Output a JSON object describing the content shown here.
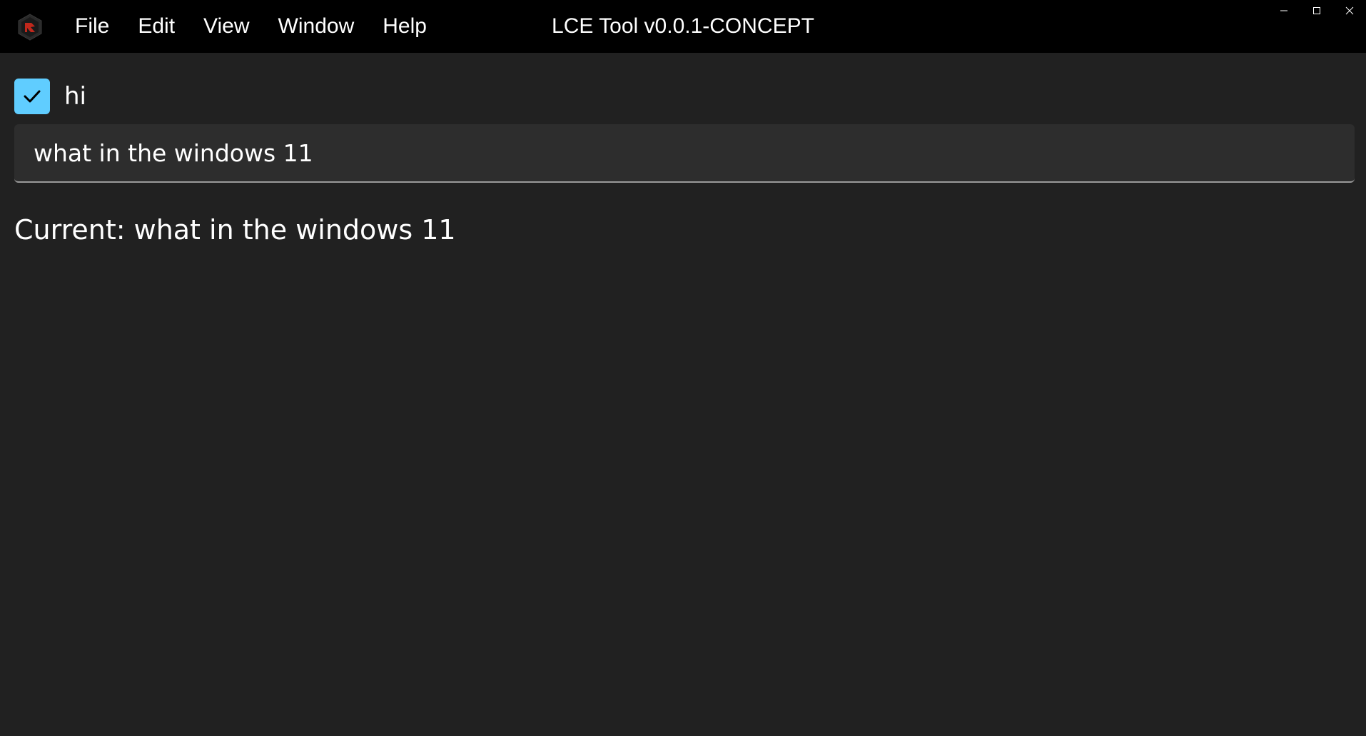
{
  "window": {
    "title": "LCE Tool v0.0.1-CONCEPT",
    "app_icon": "app-logo-icon"
  },
  "menu": {
    "items": [
      {
        "label": "File"
      },
      {
        "label": "Edit"
      },
      {
        "label": "View"
      },
      {
        "label": "Window"
      },
      {
        "label": "Help"
      }
    ]
  },
  "caption": {
    "icons": [
      "minimize-icon",
      "maximize-icon",
      "close-icon"
    ]
  },
  "main": {
    "checkbox": {
      "label": "hi",
      "checked": true,
      "accent_color": "#60cdff"
    },
    "text_input": {
      "value": "what in the windows 11"
    },
    "current": {
      "prefix": "Current: ",
      "value": "what in the windows 11"
    }
  },
  "colors": {
    "titlebar": "#000000",
    "background": "#212121",
    "input_bg": "#2d2d2d",
    "text": "#ffffff"
  }
}
